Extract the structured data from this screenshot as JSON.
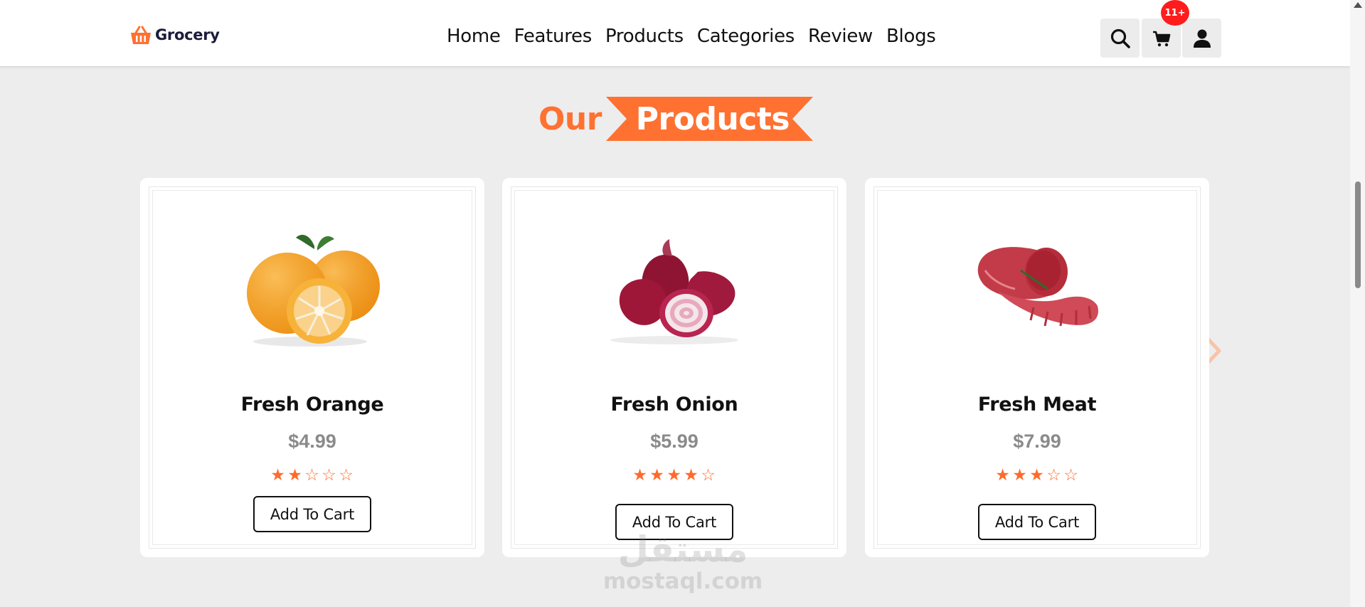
{
  "header": {
    "logo_text": "Grocery",
    "nav": [
      "Home",
      "Features",
      "Products",
      "Categories",
      "Review",
      "Blogs"
    ],
    "cart_badge": "11+"
  },
  "section": {
    "heading_plain": "Our",
    "heading_highlight": "Products"
  },
  "products": [
    {
      "name": "Fresh Orange",
      "price": "$4.99",
      "rating": 2,
      "button": "Add To Cart"
    },
    {
      "name": "Fresh Onion",
      "price": "$5.99",
      "rating": 4,
      "button": "Add To Cart"
    },
    {
      "name": "Fresh Meat",
      "price": "$7.99",
      "rating": 3,
      "button": "Add To Cart"
    }
  ],
  "watermark": {
    "arabic": "مستقل",
    "latin": "mostaql.com"
  },
  "colors": {
    "accent": "#ff7131",
    "badge": "#ff1c1c",
    "price": "#8a8a8a"
  }
}
